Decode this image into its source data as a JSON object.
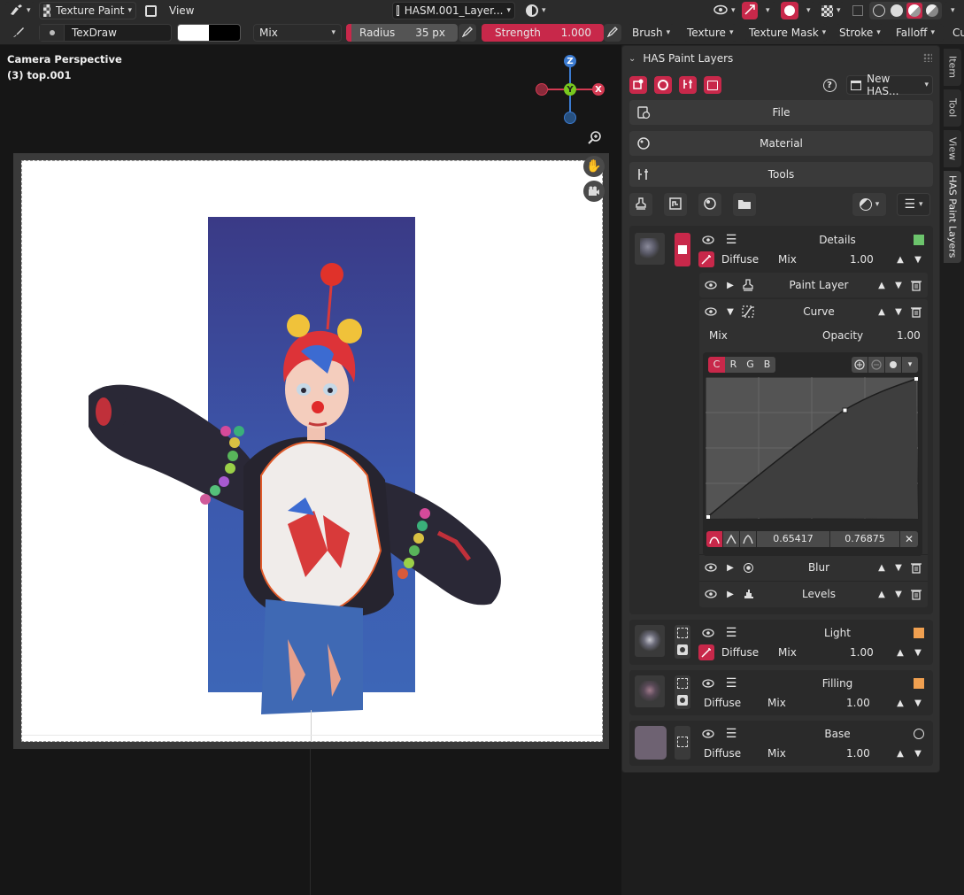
{
  "header": {
    "mode": "Texture Paint",
    "menu_view": "View",
    "image_name": "HASM.001_Layer...",
    "overlay_icons": [
      "eye-icon",
      "gizmo-icon",
      "overlay-icon",
      "checker-icon",
      "shading-icons"
    ]
  },
  "toolbar": {
    "brush_name": "TexDraw",
    "blend_mode": "Mix",
    "radius_label": "Radius",
    "radius_value": "35 px",
    "strength_label": "Strength",
    "strength_value": "1.000",
    "menus": [
      "Brush",
      "Texture",
      "Texture Mask",
      "Stroke",
      "Falloff",
      "Cu"
    ]
  },
  "viewport": {
    "title": "Camera Perspective",
    "subtitle": "(3) top.001",
    "gizmo": {
      "z": "Z",
      "y": "Y",
      "x": "X"
    }
  },
  "side_tabs": [
    "Item",
    "Tool",
    "View",
    "HAS Paint Layers"
  ],
  "panel": {
    "title": "HAS Paint Layers",
    "new_button": "New HAS...",
    "buttons": {
      "file": "File",
      "material": "Material",
      "tools": "Tools"
    },
    "layers": [
      {
        "name": "Details",
        "channel": "Diffuse",
        "blend": "Mix",
        "value": "1.00",
        "swatch": "#6cc46c",
        "sublayers": [
          {
            "name": "Paint Layer",
            "expanded": false
          },
          {
            "name": "Curve",
            "expanded": true
          }
        ],
        "curve": {
          "blend": "Mix",
          "opacity_label": "Opacity",
          "opacity_value": "1.00",
          "channels": [
            "C",
            "R",
            "G",
            "B"
          ],
          "point_x": "0.65417",
          "point_y": "0.76875"
        },
        "more_sublayers": [
          {
            "name": "Blur"
          },
          {
            "name": "Levels"
          }
        ]
      },
      {
        "name": "Light",
        "channel": "Diffuse",
        "blend": "Mix",
        "value": "1.00",
        "swatch": "#f0a050"
      },
      {
        "name": "Filling",
        "channel": "Diffuse",
        "blend": "Mix",
        "value": "1.00",
        "swatch": "#f0a050"
      },
      {
        "name": "Base",
        "channel": "Diffuse",
        "blend": "Mix",
        "value": "1.00",
        "swatch": "none"
      }
    ]
  },
  "colors": {
    "accent": "#c8284a",
    "panel_bg": "#303030",
    "viewport_bg": "#161616",
    "canvas_bg": "#ffffff"
  }
}
